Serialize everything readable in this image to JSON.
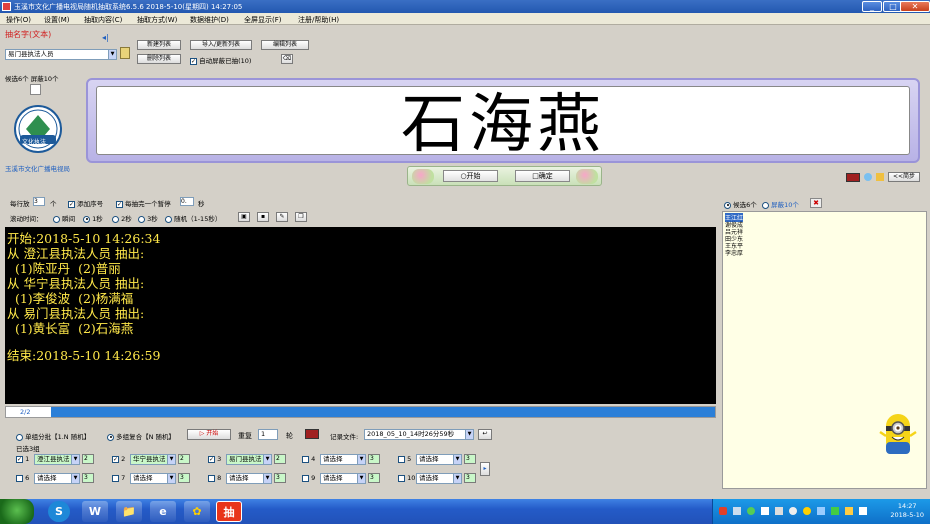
{
  "window": {
    "title": "玉溪市文化广播电视局随机抽取系统6.5.6 2018-5-10(星期四) 14:27:05",
    "controls": [
      "_",
      "□",
      "✕"
    ]
  },
  "menu": [
    "操作(O)",
    "设置(M)",
    "抽取内容(C)",
    "抽取方式(W)",
    "数据维护(D)",
    "全屏显示(F)",
    "注册/帮助(H)"
  ],
  "top": {
    "mode_label": "抽名字(文本)",
    "list_select": "易门县执法人员",
    "buttons": {
      "new_list": "新建列表",
      "import_list": "导入/更新列表",
      "edit_list": "编辑列表",
      "delete_list": "删除列表"
    },
    "auto_hide": "自动屏蔽已抽(10)",
    "candidates_status": "候选6个  屏蔽10个",
    "org_name": "玉溪市文化广播电视局",
    "logo_text": "文化执法"
  },
  "display": {
    "name": "石海燕"
  },
  "start_panel": {
    "start_label": "○开始",
    "confirm_label": "□确定"
  },
  "options": {
    "per_draw_label": "每行放",
    "per_draw_value": "3",
    "per_draw_unit": "个",
    "add_serial": "添加序号",
    "pause_each": "每抽完一个暂停",
    "pause_value": "0.",
    "pause_unit": "秒",
    "scroll_label": "滚动时间：",
    "scroll_options": [
      "瞬间",
      "1秒",
      "2秒",
      "3秒",
      "随机（1-15秒）"
    ]
  },
  "right_panel": {
    "candidates": "候选6个",
    "hidden": "屏蔽10个",
    "less_button": "<<简步",
    "names": [
      "王江红",
      "谢俊成",
      "吕元祥",
      "田少东",
      "王东平",
      "李忠厚"
    ]
  },
  "console_lines": [
    "开始:2018-5-10 14:26:34",
    "从 澄江县执法人员 抽出:",
    "  (1)陈亚丹  (2)普丽",
    "从 华宁县执法人员 抽出:",
    "  (1)李俊波  (2)杨满福",
    "从 易门县执法人员 抽出:",
    "  (1)黄长富  (2)石海燕",
    "",
    "结束:2018-5-10 14:26:59"
  ],
  "progress": {
    "label": "2/2",
    "fraction": 1.0
  },
  "bottom": {
    "mode_single": "单组分批【1.N 随机】",
    "mode_multi": "多组复合【N 随机】",
    "start_small": "开始",
    "repeat_label": "重复",
    "repeat_value": "1",
    "round_label": "轮",
    "record_label": "记录文件:",
    "record_value": "2018_05_10_14时26分59秒",
    "selected_count": "已选3组",
    "groups": [
      {
        "num": "1",
        "checked": true,
        "list": "澄江县执法",
        "count": "2"
      },
      {
        "num": "2",
        "checked": true,
        "list": "华宁县执法",
        "count": "2"
      },
      {
        "num": "3",
        "checked": true,
        "list": "易门县执法",
        "count": "2"
      },
      {
        "num": "4",
        "checked": false,
        "list": "请选择",
        "count": "3"
      },
      {
        "num": "5",
        "checked": false,
        "list": "请选择",
        "count": "3"
      },
      {
        "num": "6",
        "checked": false,
        "list": "请选择",
        "count": "3"
      },
      {
        "num": "7",
        "checked": false,
        "list": "请选择",
        "count": "3"
      },
      {
        "num": "8",
        "checked": false,
        "list": "请选择",
        "count": "3"
      },
      {
        "num": "9",
        "checked": false,
        "list": "请选择",
        "count": "3"
      },
      {
        "num": "10",
        "checked": false,
        "list": "请选择",
        "count": "3"
      }
    ]
  },
  "taskbar": {
    "apps": [
      "S",
      "W",
      "📁",
      "e",
      "✿",
      "抽"
    ],
    "time": "14:27",
    "date": "2018-5-10"
  },
  "colors": {
    "console_bg": "#000000",
    "console_text": "#ffe84a",
    "title_red": "#d02020",
    "progress": "#2b7fd8",
    "list_bg": "#ffffe6"
  }
}
